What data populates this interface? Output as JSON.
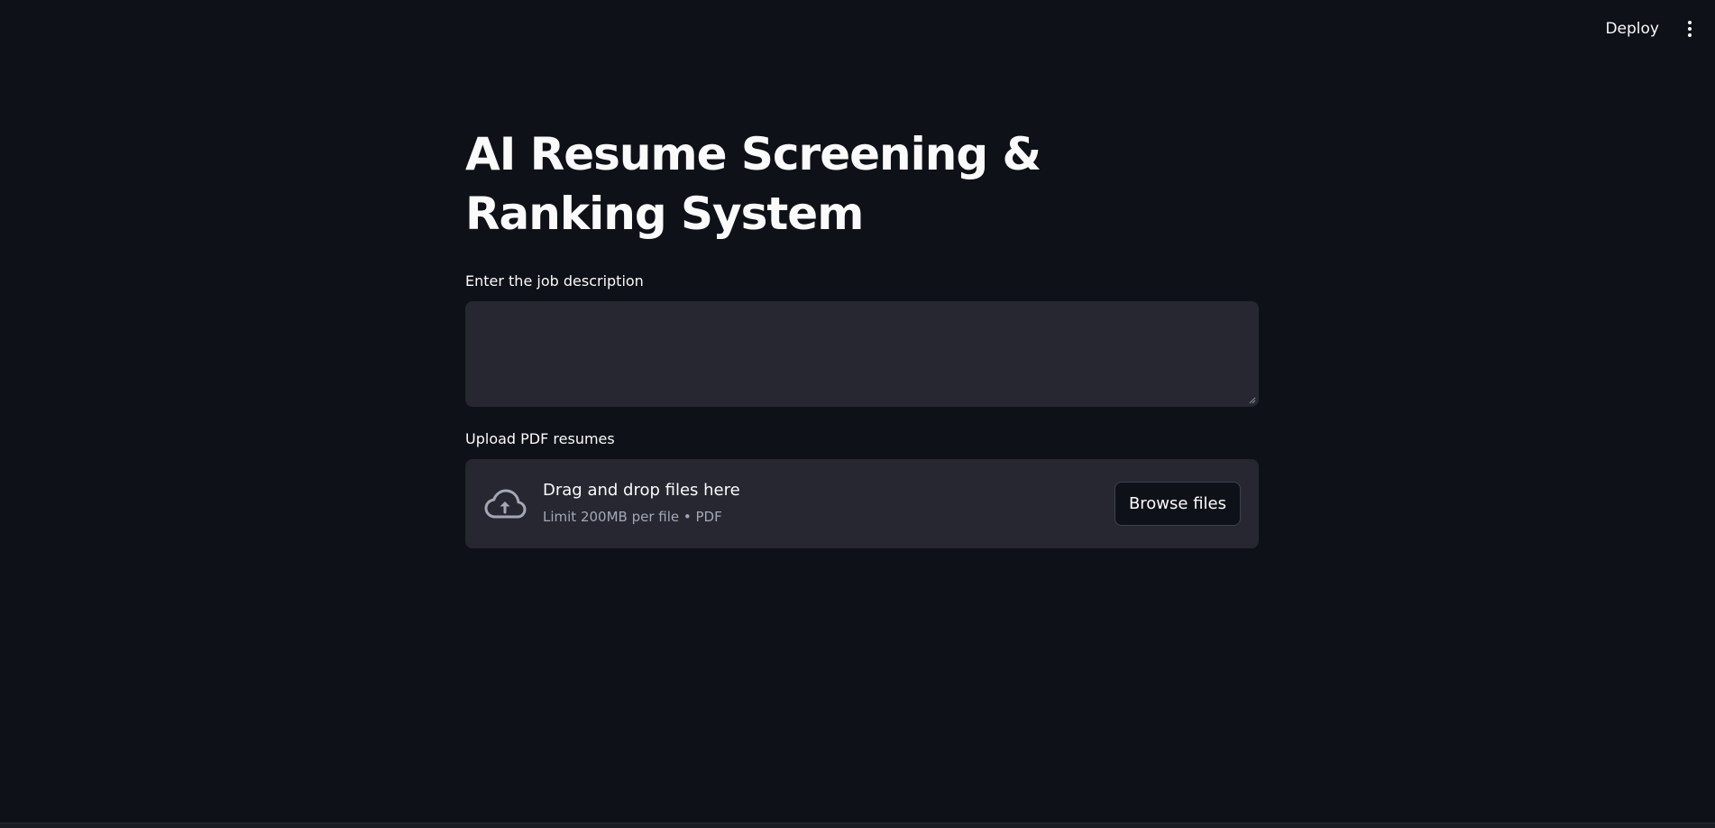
{
  "header": {
    "deploy_label": "Deploy",
    "menu_icon": "vertical-ellipsis-icon"
  },
  "main": {
    "title": "AI Resume Screening & Ranking System",
    "job_description": {
      "label": "Enter the job description",
      "value": "",
      "placeholder": ""
    },
    "uploader": {
      "label": "Upload PDF resumes",
      "drop_title": "Drag and drop files here",
      "drop_subtitle": "Limit 200MB per file • PDF",
      "browse_label": "Browse files",
      "icon": "cloud-upload-icon"
    }
  },
  "colors": {
    "background": "#0e1117",
    "surface": "#262730",
    "text": "#fafafa",
    "muted_text": "#a3a8b8"
  }
}
